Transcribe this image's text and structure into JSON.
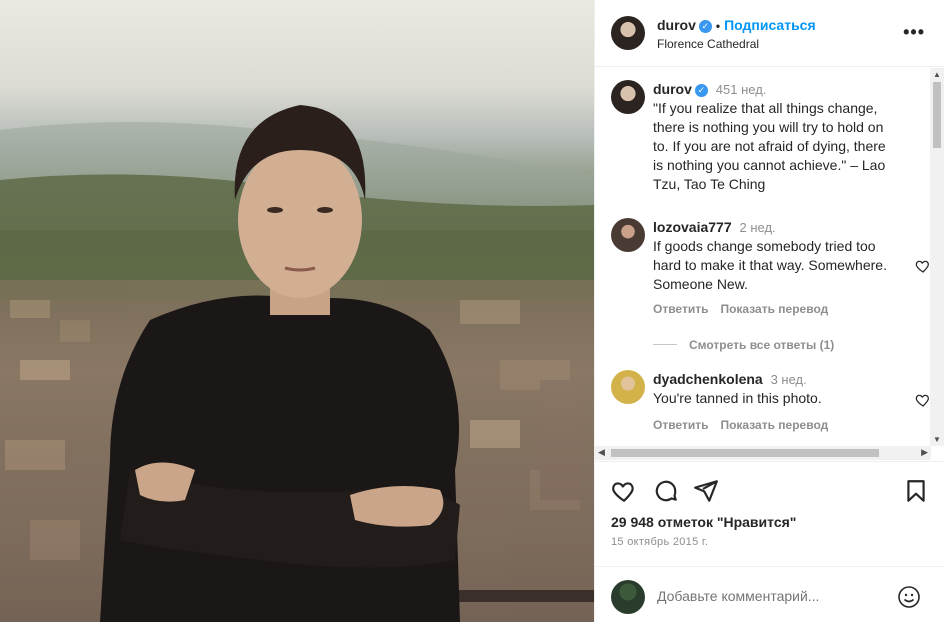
{
  "post": {
    "username": "durov",
    "follow_label": "Подписаться",
    "separator": "•",
    "location": "Florence Cathedral",
    "more_label": "•••",
    "caption_time": "451 нед.",
    "caption": "\"If you realize that all things change, there is nothing you will try to hold on to. If you are not afraid of dying, there is nothing you cannot achieve.\" – Lao Tzu, Tao Te Ching"
  },
  "comments": [
    {
      "username": "lozovaia777",
      "time": "2 нед.",
      "text": "If goods change somebody tried too hard to make it that way. Somewhere. Someone New.",
      "reply_label": "Ответить",
      "translate_label": "Показать перевод"
    },
    {
      "username": "dyadchenkolena",
      "time": "3 нед.",
      "text": "You're tanned in this photo.",
      "reply_label": "Ответить",
      "translate_label": "Показать перевод"
    }
  ],
  "view_replies": "Смотреть все ответы (1)",
  "footer": {
    "likes": "29 948 отметок \"Нравится\"",
    "date": "15 октябрь 2015 г.",
    "comment_placeholder": "Добавьте комментарий..."
  },
  "icons": {
    "verified": "✓",
    "scroll_up": "▲",
    "scroll_down": "▼",
    "scroll_left": "◀",
    "scroll_right": "▶"
  },
  "colors": {
    "accent": "#0095f6",
    "verified": "#3897f0",
    "muted": "#8e8e8e",
    "text": "#262626"
  }
}
